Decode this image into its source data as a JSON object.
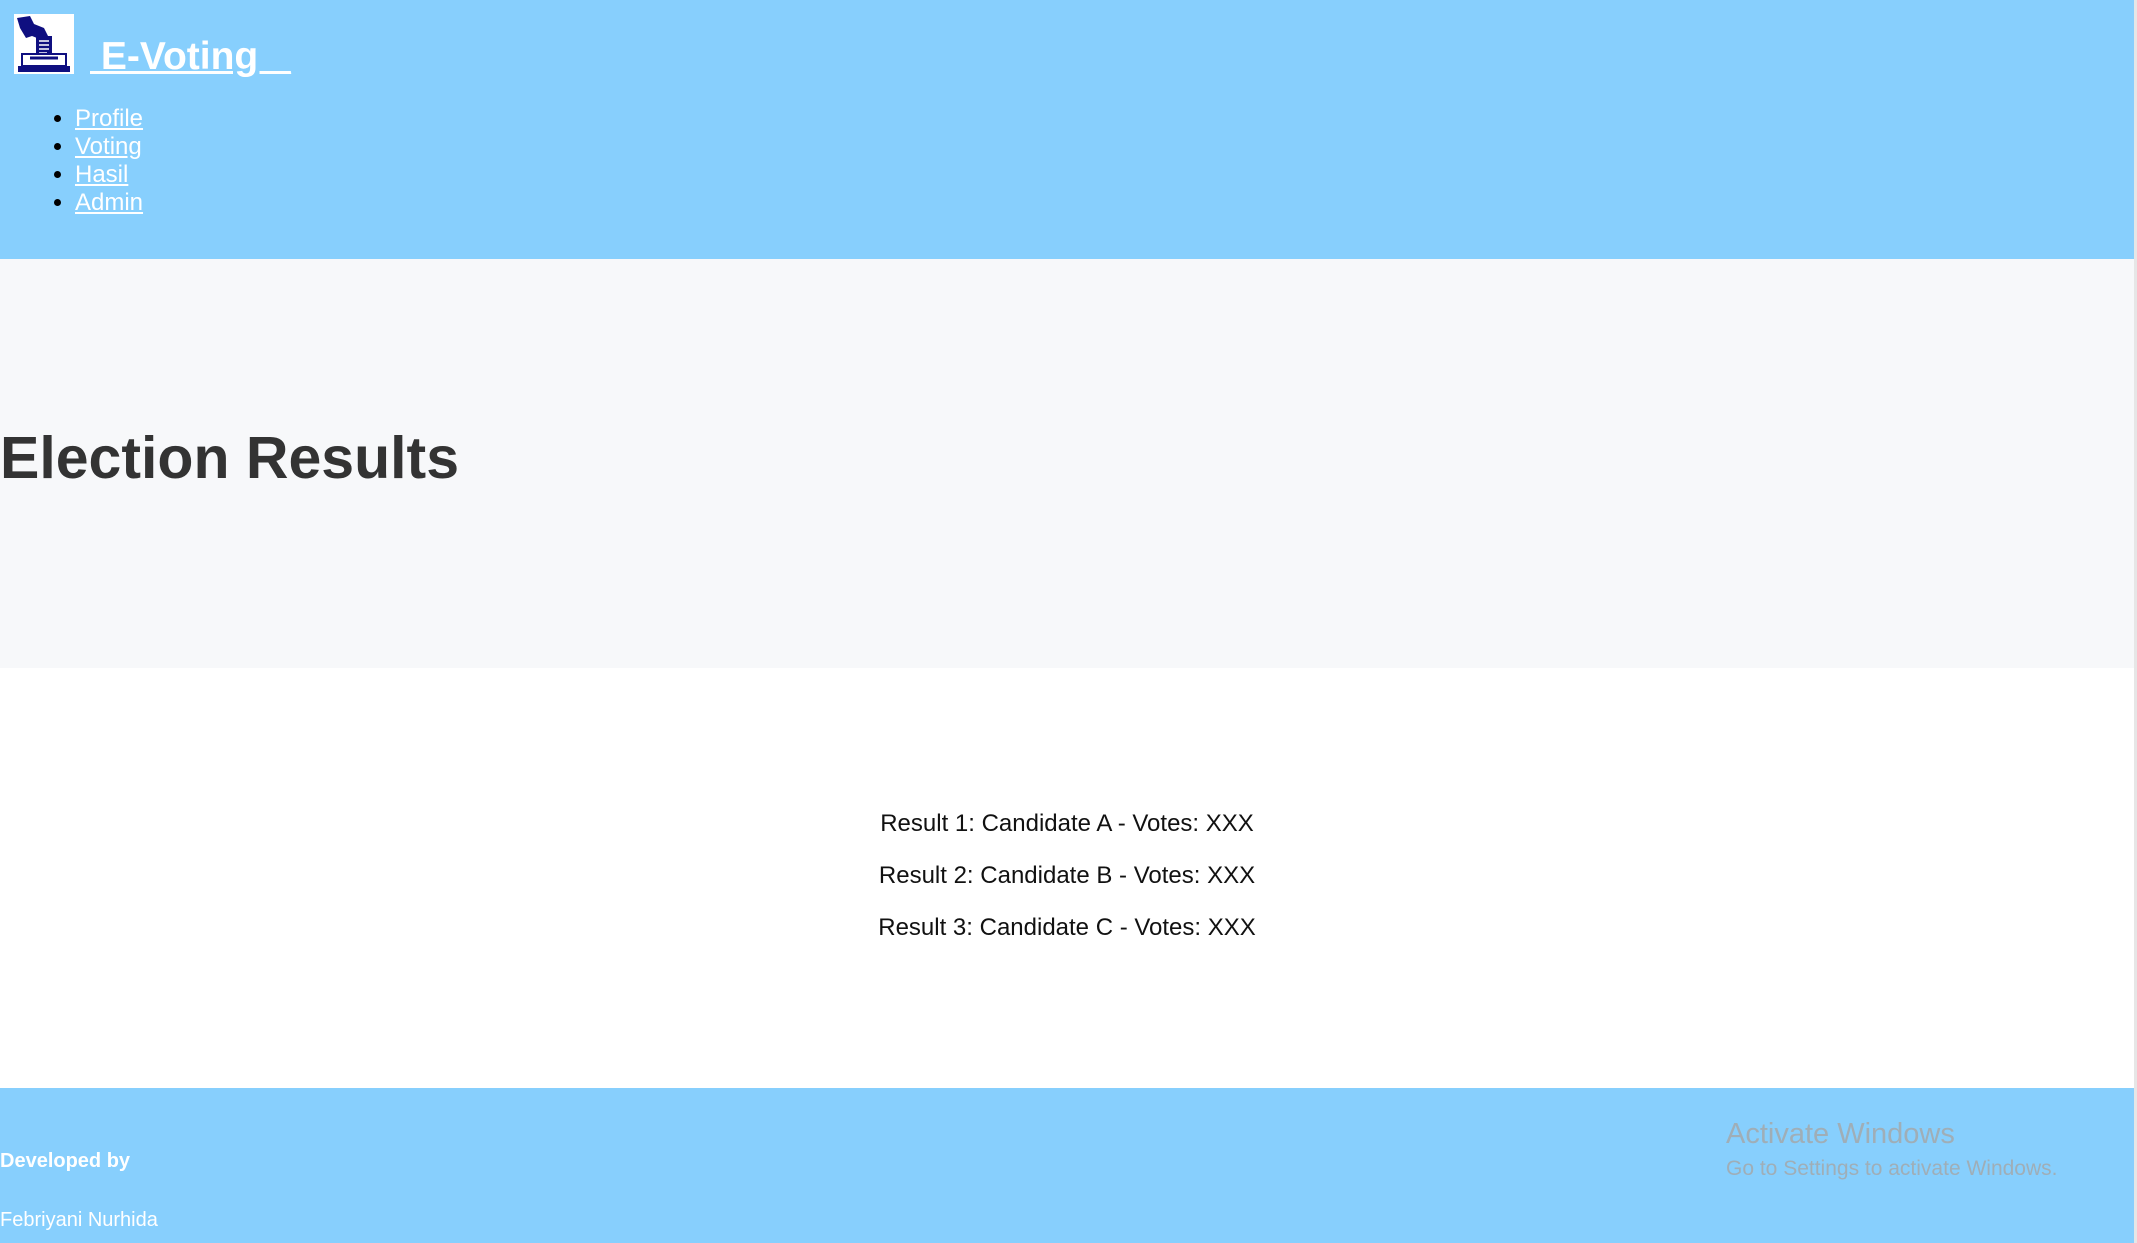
{
  "header": {
    "brand": " E-Voting _",
    "logo_icon": "ballot-box-icon",
    "nav": [
      {
        "label": "Profile"
      },
      {
        "label": "Voting"
      },
      {
        "label": "Hasil"
      },
      {
        "label": "Admin"
      }
    ],
    "background": "#87cffd"
  },
  "hero": {
    "title": "Election Results"
  },
  "results": [
    {
      "text": "Result 1: Candidate A - Votes: XXX"
    },
    {
      "text": "Result 2: Candidate B - Votes: XXX"
    },
    {
      "text": "Result 3: Candidate C - Votes: XXX"
    }
  ],
  "footer": {
    "developed_by": "Developed by",
    "developer": "Febriyani Nurhida"
  },
  "watermark": {
    "title": "Activate Windows",
    "subtitle": "Go to Settings to activate Windows."
  }
}
